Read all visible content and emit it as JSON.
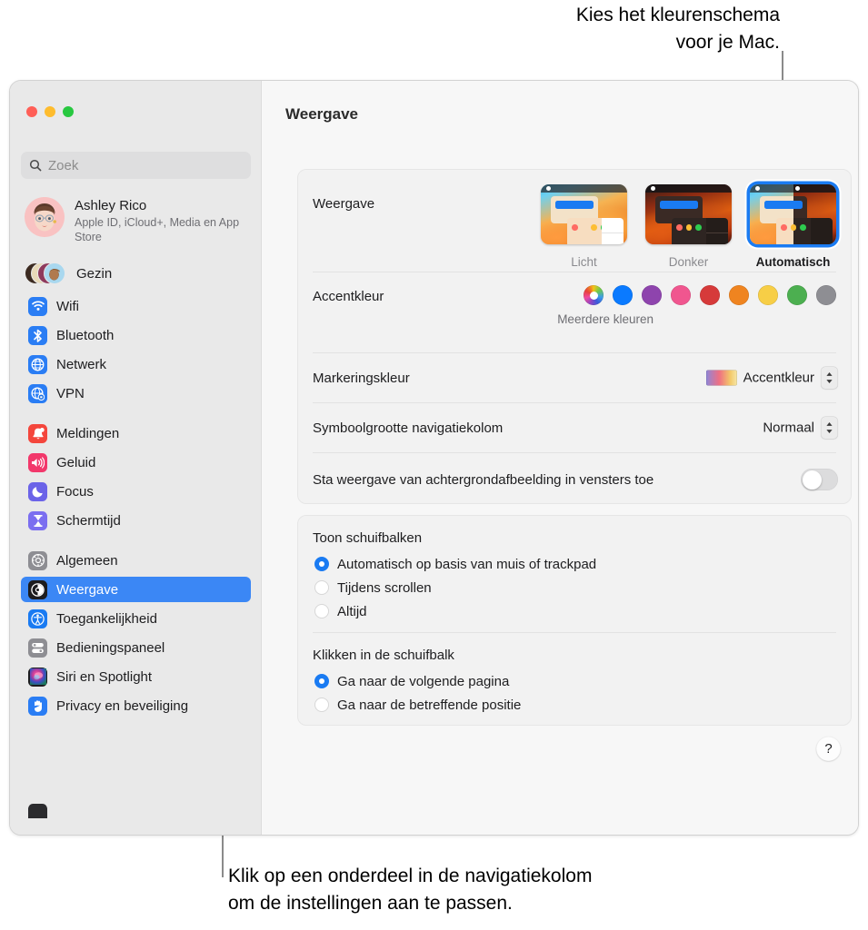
{
  "callouts": {
    "top": "Kies het kleurenschema\nvoor je Mac.",
    "bottom": "Klik op een onderdeel in de navigatiekolom\nom de instellingen aan te passen."
  },
  "window": {
    "title": "Weergave",
    "traffic_lights": [
      "close",
      "minimize",
      "zoom"
    ]
  },
  "sidebar": {
    "search": {
      "placeholder": "Zoek",
      "value": "",
      "icon": "search-icon"
    },
    "account": {
      "name": "Ashley Rico",
      "subtitle": "Apple ID, iCloud+, Media en App Store"
    },
    "family": {
      "label": "Gezin"
    },
    "groups": [
      {
        "items": [
          {
            "label": "Wifi",
            "icon": "wifi-icon",
            "color": "#2a7df4",
            "selected": false
          },
          {
            "label": "Bluetooth",
            "icon": "bluetooth-icon",
            "color": "#2a7df4",
            "selected": false
          },
          {
            "label": "Netwerk",
            "icon": "globe-icon",
            "color": "#2a7df4",
            "selected": false
          },
          {
            "label": "VPN",
            "icon": "vpn-globe-icon",
            "color": "#2a7df4",
            "selected": false
          }
        ]
      },
      {
        "items": [
          {
            "label": "Meldingen",
            "icon": "bell-icon",
            "color": "#f4463c",
            "selected": false
          },
          {
            "label": "Geluid",
            "icon": "speaker-icon",
            "color": "#f2386b",
            "selected": false
          },
          {
            "label": "Focus",
            "icon": "moon-icon",
            "color": "#6b63e8",
            "selected": false
          },
          {
            "label": "Schermtijd",
            "icon": "hourglass-icon",
            "color": "#7b6ef0",
            "selected": false
          }
        ]
      },
      {
        "items": [
          {
            "label": "Algemeen",
            "icon": "gear-icon",
            "color": "#8e8e93",
            "selected": false
          },
          {
            "label": "Weergave",
            "icon": "appearance-icon",
            "color": "#1c1c1e",
            "selected": true
          },
          {
            "label": "Toegankelijkheid",
            "icon": "accessibility-icon",
            "color": "#1a7bf2",
            "selected": false
          },
          {
            "label": "Bedieningspaneel",
            "icon": "control-center-icon",
            "color": "#8e8e93",
            "selected": false
          },
          {
            "label": "Siri en Spotlight",
            "icon": "siri-icon",
            "color": "#1c1c1e",
            "selected": false
          },
          {
            "label": "Privacy en beveiliging",
            "icon": "hand-icon",
            "color": "#2a7df4",
            "selected": false
          }
        ]
      }
    ]
  },
  "main": {
    "appearance": {
      "label": "Weergave",
      "themes": [
        {
          "name": "Licht",
          "selected": false
        },
        {
          "name": "Donker",
          "selected": false
        },
        {
          "name": "Automatisch",
          "selected": true
        }
      ]
    },
    "accent": {
      "label": "Accentkleur",
      "caption": "Meerdere kleuren",
      "colors": [
        {
          "name": "multicolor",
          "hex": "multi"
        },
        {
          "name": "blue",
          "hex": "#0a7aff"
        },
        {
          "name": "purple",
          "hex": "#8e44ad"
        },
        {
          "name": "pink",
          "hex": "#f0568f"
        },
        {
          "name": "red",
          "hex": "#d63a3a"
        },
        {
          "name": "orange",
          "hex": "#ef8420"
        },
        {
          "name": "yellow",
          "hex": "#f7ce46"
        },
        {
          "name": "green",
          "hex": "#53b martinez"
        },
        {
          "name": "graphite",
          "hex": "#8e8e93"
        }
      ]
    },
    "highlight": {
      "label": "Markeringskleur",
      "value": "Accentkleur"
    },
    "sidebar_icon_size": {
      "label": "Symboolgrootte navigatiekolom",
      "value": "Normaal"
    },
    "wallpaper_tinting": {
      "label": "Sta weergave van achtergrondafbeelding in vensters toe",
      "enabled": false
    },
    "show_scrollbars": {
      "label": "Toon schuifbalken",
      "options": [
        {
          "label": "Automatisch op basis van muis of trackpad",
          "selected": true
        },
        {
          "label": "Tijdens scrollen",
          "selected": false
        },
        {
          "label": "Altijd",
          "selected": false
        }
      ]
    },
    "click_scrollbar": {
      "label": "Klikken in de schuifbalk",
      "options": [
        {
          "label": "Ga naar de volgende pagina",
          "selected": true
        },
        {
          "label": "Ga naar de betreffende positie",
          "selected": false
        }
      ]
    },
    "help": {
      "label": "?"
    }
  }
}
